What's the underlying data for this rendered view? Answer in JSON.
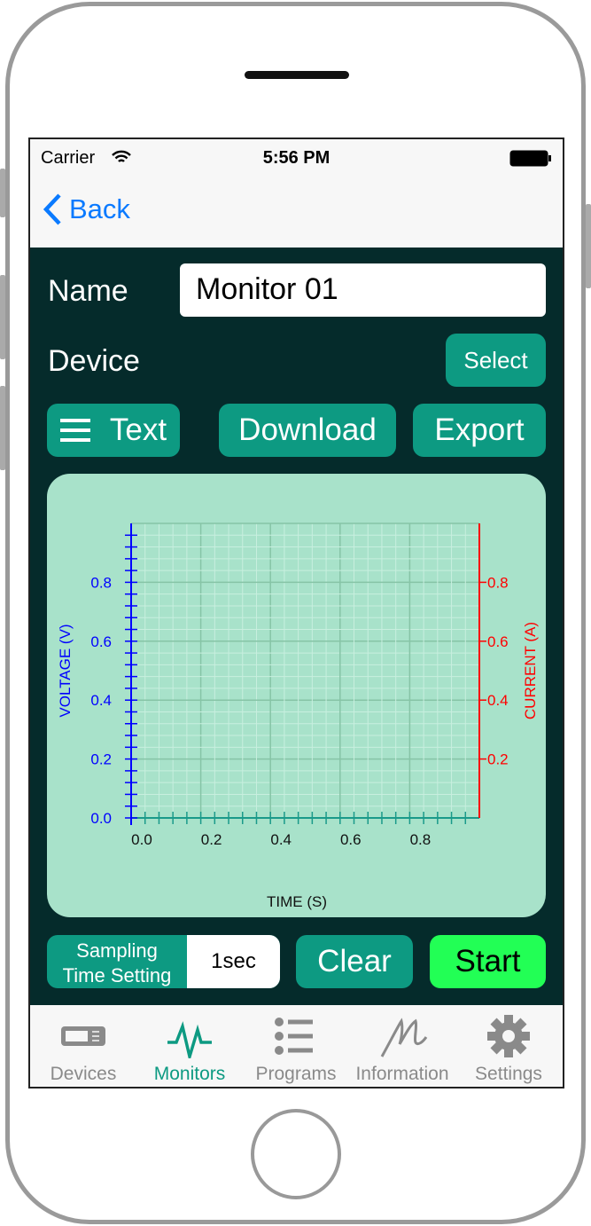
{
  "status": {
    "carrier": "Carrier",
    "time": "5:56 PM"
  },
  "nav": {
    "back_label": "Back"
  },
  "form": {
    "name_label": "Name",
    "name_value": "Monitor 01",
    "device_label": "Device",
    "select_label": "Select"
  },
  "toolbar": {
    "text_label": "Text",
    "download_label": "Download",
    "export_label": "Export"
  },
  "chart_data": {
    "type": "line",
    "xlabel": "TIME (S)",
    "ylabel": "VOLTAGE (V)",
    "y2label": "CURRENT (A)",
    "xlim": [
      0,
      1
    ],
    "ylim": [
      0,
      1
    ],
    "y2lim": [
      0,
      1
    ],
    "xticks": [
      "0.0",
      "0.2",
      "0.4",
      "0.6",
      "0.8"
    ],
    "yticks": [
      "0.0",
      "0.2",
      "0.4",
      "0.6",
      "0.8"
    ],
    "y2ticks": [
      "0.2",
      "0.4",
      "0.6",
      "0.8"
    ],
    "grid": true,
    "series": [],
    "colors": {
      "voltage": "#0000ff",
      "current": "#ff0000",
      "time": "#1a9a8a"
    }
  },
  "bottom": {
    "sampling_label_1": "Sampling",
    "sampling_label_2": "Time Setting",
    "sampling_value": "1sec",
    "clear_label": "Clear",
    "start_label": "Start"
  },
  "tabs": [
    {
      "label": "Devices",
      "icon": "device-icon"
    },
    {
      "label": "Monitors",
      "icon": "pulse-icon",
      "active": true
    },
    {
      "label": "Programs",
      "icon": "list-icon"
    },
    {
      "label": "Information",
      "icon": "logo-m-icon"
    },
    {
      "label": "Settings",
      "icon": "gear-icon"
    }
  ],
  "colors": {
    "accent": "#0d9a82",
    "background": "#052b2b",
    "start": "#22ff55",
    "link": "#0a7aff"
  }
}
